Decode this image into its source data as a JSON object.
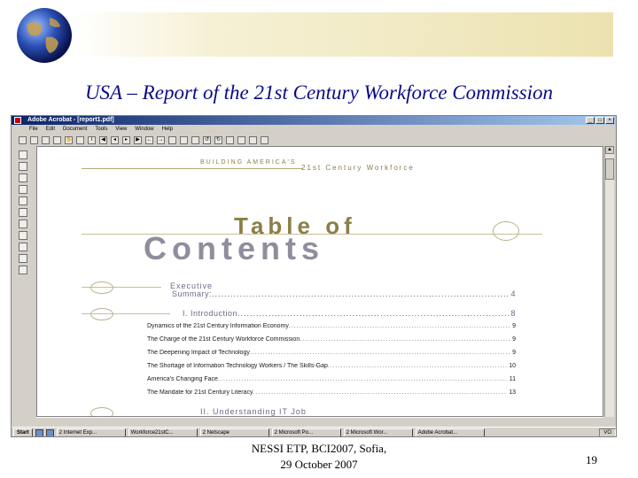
{
  "slide": {
    "title": "USA – Report of the 21st Century Workforce Commission",
    "footer_line1": "NESSI ETP, BCI2007, Sofia,",
    "footer_line2": "29 October 2007",
    "page_number": "19"
  },
  "window": {
    "title": "Adobe Acrobat - [report1.pdf]",
    "menu": [
      "File",
      "Edit",
      "Document",
      "Tools",
      "View",
      "Window",
      "Help"
    ]
  },
  "document": {
    "header_left": "BUILDING AMERICA'S",
    "header_right": "21st Century Workforce",
    "title_line1": "Table of",
    "title_line2": "Contents",
    "sections": [
      {
        "label": "Executive",
        "label2": "Summary:",
        "page": "4"
      },
      {
        "label": "I.  Introduction",
        "page": "8"
      }
    ],
    "entries": [
      {
        "label": "Dynamics of the 21st Century Information Economy",
        "page": "9"
      },
      {
        "label": "The Charge of the 21st Century Workforce Commission",
        "page": "9"
      },
      {
        "label": "The Deepening Impact of Technology",
        "page": "9"
      },
      {
        "label": "The Shortage of Information Technology Workers / The Skills-Gap",
        "page": "10"
      },
      {
        "label": "America's Changing Face",
        "page": "11"
      },
      {
        "label": "The Mandate for 21st Century Literacy",
        "page": "13"
      }
    ],
    "next_section": "II.  Understanding IT Job"
  },
  "taskbar": {
    "start": "Start",
    "tasks": [
      "2 Internet Exp...",
      "Workforce21stC...",
      "2 Netscape",
      "2 Microsoft Po...",
      "2 Microsoft Wor...",
      "Adobe Acrobat..."
    ],
    "tray": "VO"
  }
}
